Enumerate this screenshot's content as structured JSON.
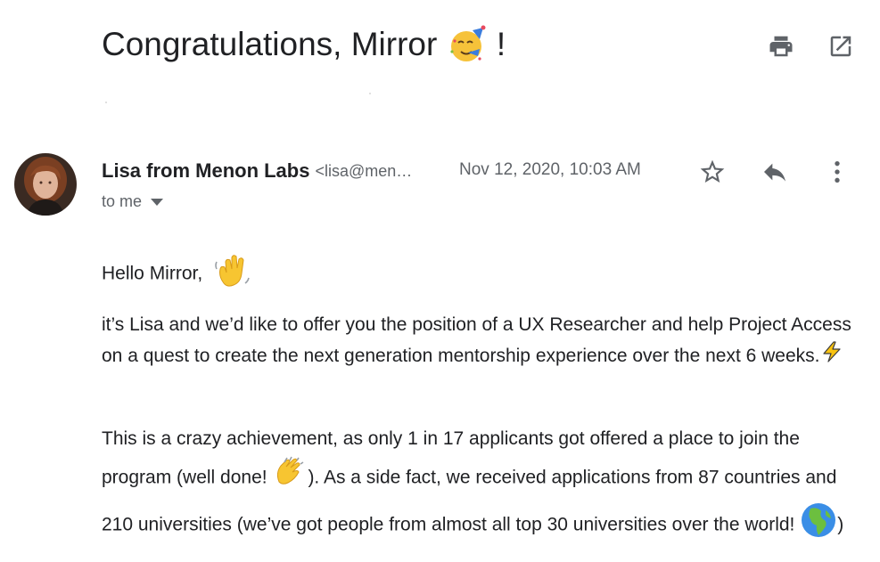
{
  "email": {
    "subject_prefix": "Congratulations, Mirror",
    "subject_suffix": "!",
    "sender_name": "Lisa from Menon Labs",
    "sender_email": "<lisa@men…",
    "date": "Nov 12, 2020, 10:03 AM",
    "recipient_label": "to me"
  },
  "icons": {
    "print": "print-icon",
    "open_new": "open-in-new-window-icon",
    "star": "star-icon",
    "reply": "reply-icon",
    "more": "more-vertical-icon",
    "dropdown": "chevron-down-icon",
    "subject_emoji": "partying-face-emoji",
    "wave": "waving-hand-emoji",
    "bolt": "lightning-emoji",
    "clap": "clapping-hands-emoji",
    "globe": "globe-emoji"
  },
  "body": {
    "greeting": "Hello Mirror,",
    "p1_text": "it’s Lisa and we’d like to offer you the position of a UX Researcher and help Project Access on a quest to create the next generation mentorship experience over the next 6 weeks.",
    "p2_a": "This is a crazy achievement, as only 1 in 17 applicants got offered a place to join the program (well done!",
    "p2_b": "). As a side fact, we received applications from 87 countries and 210 universities (we’ve got people from almost all top 30 universities over the world!",
    "p2_c": ")"
  },
  "colors": {
    "text": "#202124",
    "secondary": "#5f6368",
    "icon": "#5f6368"
  }
}
